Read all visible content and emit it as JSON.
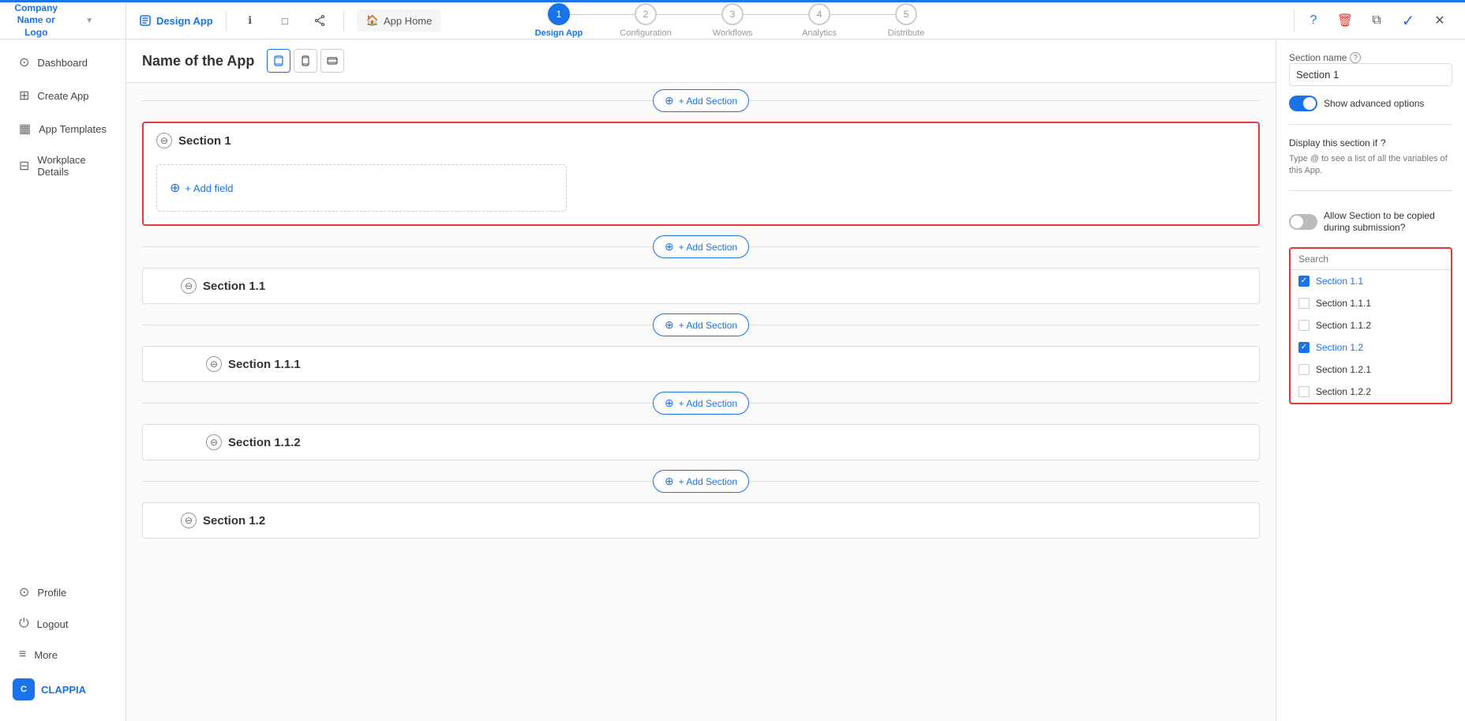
{
  "topBar": {
    "company": "Company Name or Logo",
    "designApp": "Design App",
    "appHome": "App Home",
    "steps": [
      {
        "number": "1",
        "label": "Design App",
        "active": true
      },
      {
        "number": "2",
        "label": "Configuration",
        "active": false
      },
      {
        "number": "3",
        "label": "Workflows",
        "active": false
      },
      {
        "number": "4",
        "label": "Analytics",
        "active": false
      },
      {
        "number": "5",
        "label": "Distribute",
        "active": false
      }
    ]
  },
  "sidebar": {
    "items": [
      {
        "id": "dashboard",
        "label": "Dashboard",
        "icon": "⊙"
      },
      {
        "id": "create-app",
        "label": "Create App",
        "icon": "⊞"
      },
      {
        "id": "app-templates",
        "label": "App Templates",
        "icon": "▦"
      },
      {
        "id": "workplace-details",
        "label": "Workplace Details",
        "icon": "⊟"
      }
    ],
    "bottomItems": [
      {
        "id": "profile",
        "label": "Profile",
        "icon": "⊙"
      },
      {
        "id": "logout",
        "label": "Logout",
        "icon": "⏻"
      },
      {
        "id": "more",
        "label": "More",
        "icon": "≡"
      }
    ],
    "brand": "CLAPPIA"
  },
  "canvas": {
    "appName": "Name of the App",
    "addSectionLabel": "+ Add Section",
    "addFieldLabel": "+ Add field",
    "sections": [
      {
        "id": "section1",
        "title": "Section 1",
        "selected": true,
        "hasField": true,
        "subsections": []
      },
      {
        "id": "section1-1",
        "title": "Section 1.1",
        "selected": false,
        "subsections": []
      },
      {
        "id": "section1-1-1",
        "title": "Section 1.1.1",
        "selected": false,
        "subsections": []
      },
      {
        "id": "section1-1-2",
        "title": "Section 1.1.2",
        "selected": false,
        "subsections": []
      },
      {
        "id": "section1-2",
        "title": "Section 1.2",
        "selected": false,
        "subsections": []
      }
    ]
  },
  "rightPanel": {
    "sectionNameLabel": "Section name",
    "sectionNameValue": "Section 1",
    "showAdvancedLabel": "Show advanced options",
    "displayConditionLabel": "Display this section if",
    "conditionHint": "Type @ to see a list of all the variables of this App.",
    "allowCopyLabel": "Allow Section to be copied during submission?",
    "searchPlaceholder": "Search",
    "dropdownItems": [
      {
        "id": "s1-1",
        "label": "Section 1.1",
        "checked": true
      },
      {
        "id": "s1-1-1",
        "label": "Section 1.1.1",
        "checked": false
      },
      {
        "id": "s1-1-2",
        "label": "Section 1.1.2",
        "checked": false
      },
      {
        "id": "s1-2",
        "label": "Section 1.2",
        "checked": true
      },
      {
        "id": "s1-2-1",
        "label": "Section 1.2.1",
        "checked": false
      },
      {
        "id": "s1-2-2",
        "label": "Section 1.2.2",
        "checked": false
      }
    ]
  }
}
